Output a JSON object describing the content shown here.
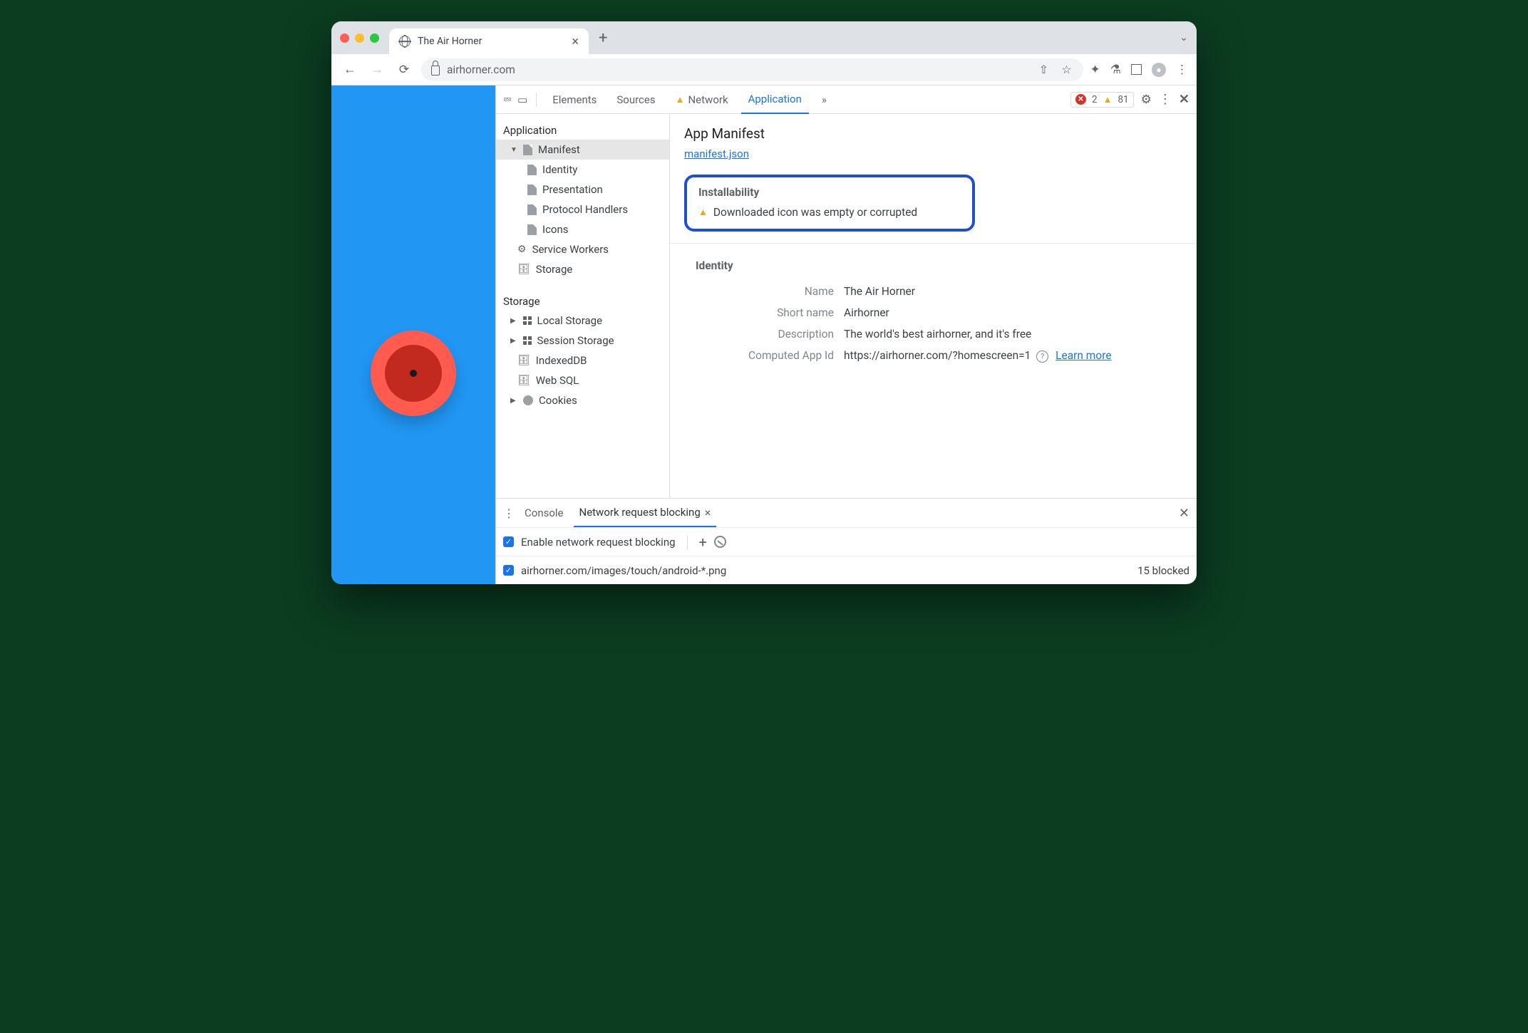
{
  "tab": {
    "title": "The Air Horner"
  },
  "omnibox": {
    "url": "airhorner.com"
  },
  "devtools": {
    "tabs": {
      "elements": "Elements",
      "sources": "Sources",
      "network": "Network",
      "application": "Application"
    },
    "errors": "2",
    "warnings": "81"
  },
  "sidebar": {
    "application": {
      "title": "Application",
      "items": {
        "manifest": "Manifest",
        "identity": "Identity",
        "presentation": "Presentation",
        "protocol": "Protocol Handlers",
        "icons": "Icons",
        "service_workers": "Service Workers",
        "storage": "Storage"
      }
    },
    "storage": {
      "title": "Storage",
      "items": {
        "local": "Local Storage",
        "session": "Session Storage",
        "idb": "IndexedDB",
        "websql": "Web SQL",
        "cookies": "Cookies"
      }
    }
  },
  "manifest": {
    "heading": "App Manifest",
    "link": "manifest.json",
    "installability": {
      "title": "Installability",
      "message": "Downloaded icon was empty or corrupted"
    },
    "identity": {
      "title": "Identity",
      "name_label": "Name",
      "name_value": "The Air Horner",
      "short_label": "Short name",
      "short_value": "Airhorner",
      "desc_label": "Description",
      "desc_value": "The world's best airhorner, and it's free",
      "appid_label": "Computed App Id",
      "appid_value": "https://airhorner.com/?homescreen=1",
      "learn_more": "Learn more"
    }
  },
  "drawer": {
    "console": "Console",
    "nrb": "Network request blocking",
    "enable_label": "Enable network request blocking",
    "pattern": "airhorner.com/images/touch/android-*.png",
    "blocked": "15 blocked"
  }
}
